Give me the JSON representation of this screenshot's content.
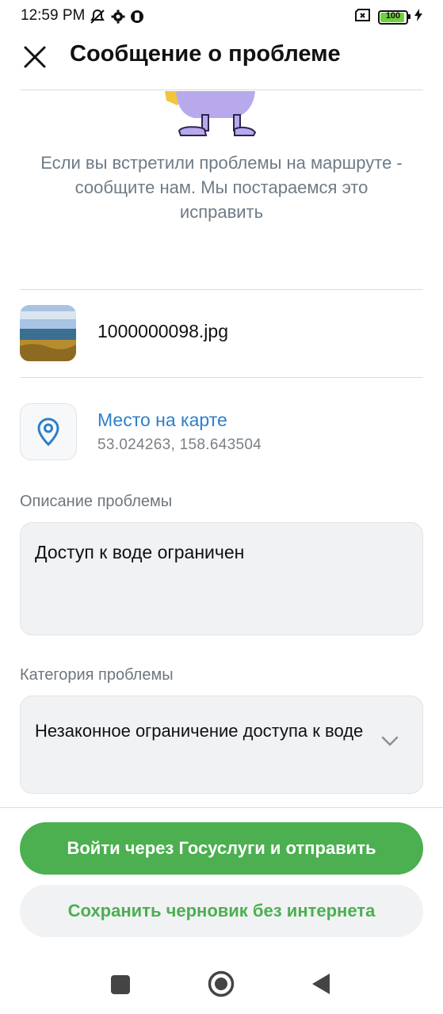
{
  "status_bar": {
    "time": "12:59 PM",
    "battery": "100",
    "icons_left": [
      "muted-icon",
      "gear-icon",
      "app-icon"
    ],
    "icons_right": [
      "sim-icon",
      "battery-icon",
      "charging-icon"
    ]
  },
  "header": {
    "title": "Сообщение о проблеме",
    "close_icon": "close-icon"
  },
  "intro": {
    "text": "Если вы встретили проблемы на маршруте - сообщите нам. Мы постараемся это исправить"
  },
  "attachment": {
    "file_name": "1000000098.jpg"
  },
  "location": {
    "title": "Место на карте",
    "coords": "53.024263, 158.643504",
    "icon": "map-pin-icon"
  },
  "description": {
    "label": "Описание проблемы",
    "value": "Доступ к воде ограничен"
  },
  "category": {
    "label": "Категория проблемы",
    "value": "Незаконное ограничение доступа к воде",
    "icon": "chevron-down-icon"
  },
  "actions": {
    "primary": "Войти через Госуслуги и отправить",
    "secondary": "Сохранить черновик без интернета"
  },
  "colors": {
    "accent_green": "#4caf50",
    "link_blue": "#2d7fc8",
    "muted_text": "#6f7b86"
  },
  "nav": {
    "buttons": [
      "recents-icon",
      "home-icon",
      "back-icon"
    ]
  }
}
